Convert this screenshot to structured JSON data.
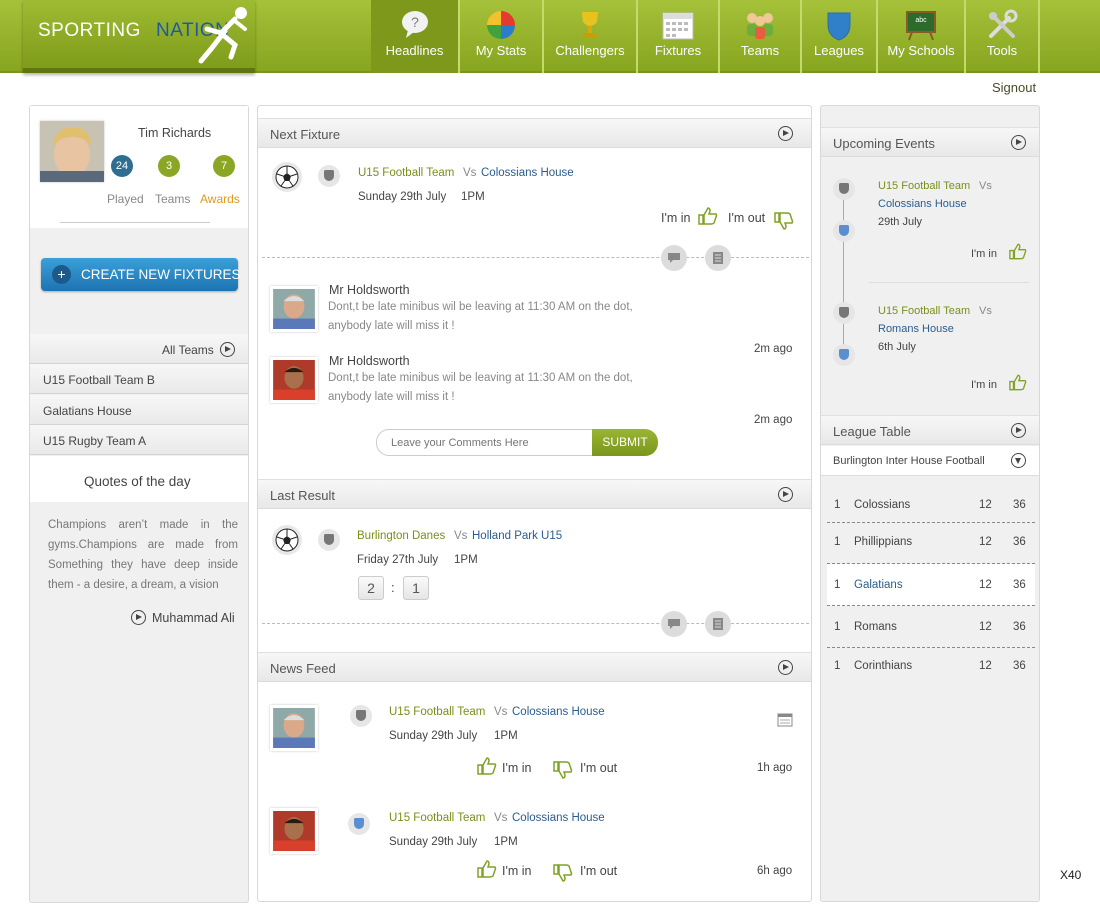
{
  "brand": {
    "part1": "SPORTING",
    "part2": "NATION"
  },
  "nav": [
    {
      "label": "Headlines",
      "icon": "speech-bubble-question-icon",
      "active": true
    },
    {
      "label": "My Stats",
      "icon": "pie-chart-icon"
    },
    {
      "label": "Challengers",
      "icon": "trophy-icon"
    },
    {
      "label": "Fixtures",
      "icon": "calendar-icon"
    },
    {
      "label": "Teams",
      "icon": "people-icon"
    },
    {
      "label": "Leagues",
      "icon": "shield-icon"
    },
    {
      "label": "My Schools",
      "icon": "chalkboard-icon"
    },
    {
      "label": "Tools",
      "icon": "tools-icon"
    }
  ],
  "signout": "Signout",
  "profile": {
    "name": "Tim Richards",
    "stats": [
      {
        "value": "24",
        "label": "Played",
        "color": "#2f6e93"
      },
      {
        "value": "3",
        "label": "Teams",
        "color": "#8aa624"
      },
      {
        "value": "7",
        "label": "Awards",
        "color": "#8aa624"
      }
    ]
  },
  "create_button": "CREATE NEW FIXTURES",
  "all_teams": "All Teams",
  "teams": [
    "U15 Football Team B",
    "Galatians House",
    "U15 Rugby Team A"
  ],
  "quote": {
    "heading": "Quotes of the day",
    "text": "Champions aren’t made in the gyms.Champions are made from Something they have deep inside them - a desire, a dream, a vision",
    "author": "Muhammad Ali"
  },
  "next_fixture": {
    "heading": "Next Fixture",
    "home": "U15 Football Team",
    "vs": "Vs",
    "away": "Colossians House",
    "date": "Sunday 29th  July",
    "time": "1PM",
    "im_in": "I'm in",
    "im_out": "I'm out"
  },
  "comments": [
    {
      "author": "Mr Holdsworth",
      "text1": "Dont,t be late minibus wil be leaving at 11:30 AM on the dot,",
      "text2": "anybody late will miss it !",
      "time": "2m ago"
    },
    {
      "author": "Mr Holdsworth",
      "text1": "Dont,t be late minibus wil be leaving at 11:30 AM on the dot,",
      "text2": "anybody late will miss it !",
      "time": "2m ago"
    }
  ],
  "comment_input": {
    "placeholder": "Leave your Comments Here",
    "submit": "SUBMIT"
  },
  "last_result": {
    "heading": "Last Result",
    "home": "Burlington Danes",
    "vs": "Vs",
    "away": "Holland Park U15",
    "date": "Friday 27th  July",
    "time": "1PM",
    "score_home": "2",
    "sep": ":",
    "score_away": "1"
  },
  "news_feed": {
    "heading": "News Feed",
    "items": [
      {
        "home": "U15 Football Team",
        "vs": "Vs",
        "away": "Colossians House",
        "date": "Sunday 29th  July",
        "time": "1PM",
        "im_in": "I'm in",
        "im_out": "I'm out",
        "ago": "1h ago"
      },
      {
        "home": "U15 Football Team",
        "vs": "Vs",
        "away": "Colossians House",
        "date": "Sunday 29th  July",
        "time": "1PM",
        "im_in": "I'm in",
        "im_out": "I'm out",
        "ago": "6h ago"
      }
    ]
  },
  "upcoming": {
    "heading": "Upcoming Events",
    "events": [
      {
        "home": "U15 Football Team",
        "vs": "Vs",
        "away": "Colossians House",
        "date": "29th  July",
        "im_in": "I'm in"
      },
      {
        "home": "U15 Football Team",
        "vs": "Vs",
        "away": "Romans House",
        "date": "6th  July",
        "im_in": "I'm in"
      }
    ]
  },
  "league": {
    "heading": "League Table",
    "selected": "Burlington Inter House Football",
    "rows": [
      {
        "pos": "1",
        "team": "Colossians",
        "p": "12",
        "pts": "36",
        "highlight": false
      },
      {
        "pos": "1",
        "team": "Phillippians",
        "p": "12",
        "pts": "36",
        "highlight": false
      },
      {
        "pos": "1",
        "team": "Galatians",
        "p": "12",
        "pts": "36",
        "highlight": true
      },
      {
        "pos": "1",
        "team": "Romans",
        "p": "12",
        "pts": "36",
        "highlight": false
      },
      {
        "pos": "1",
        "team": "Corinthians",
        "p": "12",
        "pts": "36",
        "highlight": false
      }
    ]
  },
  "zoom": "X40"
}
